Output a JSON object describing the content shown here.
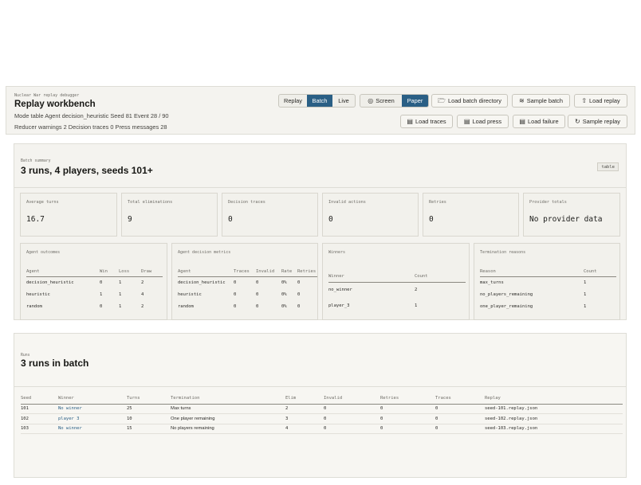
{
  "header": {
    "eyebrow": "Nuclear War replay debugger",
    "title": "Replay workbench",
    "meta_line1": "Mode table  Agent decision_heuristic  Seed 81  Event 28 / 90",
    "meta_line2": "Reducer warnings 2  Decision traces 0  Press messages 28",
    "mode_tabs": [
      "Replay",
      "Batch",
      "Live"
    ],
    "active_mode": "Batch",
    "view_tabs": [
      "Screen",
      "Paper"
    ],
    "active_view": "Paper",
    "buttons_row1": {
      "load_batch_directory": "Load batch directory",
      "sample_batch": "Sample batch",
      "load_replay": "Load replay"
    },
    "buttons_row2": {
      "load_traces": "Load traces",
      "load_press": "Load press",
      "load_failure": "Load failure",
      "sample_replay": "Sample replay"
    }
  },
  "summary": {
    "eyebrow": "Batch summary",
    "title": "3 runs, 4 players, seeds 101+",
    "tag": "table",
    "stats": [
      {
        "label": "Average turns",
        "value": "16.7"
      },
      {
        "label": "Total eliminations",
        "value": "9"
      },
      {
        "label": "Decision traces",
        "value": "0"
      },
      {
        "label": "Invalid actions",
        "value": "0"
      },
      {
        "label": "Retries",
        "value": "0"
      },
      {
        "label": "Provider totals",
        "value": "No provider data"
      }
    ],
    "agent_outcomes": {
      "label": "Agent outcomes",
      "headers": [
        "Agent",
        "Win",
        "Loss",
        "Draw"
      ],
      "rows": [
        {
          "agent": "decision_heuristic",
          "win": "0",
          "loss": "1",
          "draw": "2"
        },
        {
          "agent": "heuristic",
          "win": "1",
          "loss": "1",
          "draw": "4"
        },
        {
          "agent": "random",
          "win": "0",
          "loss": "1",
          "draw": "2"
        }
      ]
    },
    "agent_metrics": {
      "label": "Agent decision metrics",
      "headers": [
        "Agent",
        "Traces",
        "Invalid",
        "Rate",
        "Retries"
      ],
      "rows": [
        {
          "agent": "decision_heuristic",
          "traces": "0",
          "invalid": "0",
          "rate": "0%",
          "retries": "0"
        },
        {
          "agent": "heuristic",
          "traces": "0",
          "invalid": "0",
          "rate": "0%",
          "retries": "0"
        },
        {
          "agent": "random",
          "traces": "0",
          "invalid": "0",
          "rate": "0%",
          "retries": "0"
        }
      ]
    },
    "winners": {
      "label": "Winners",
      "headers": [
        "Winner",
        "Count"
      ],
      "rows": [
        {
          "winner": "no_winner",
          "count": "2"
        },
        {
          "winner": "player_3",
          "count": "1"
        }
      ]
    },
    "termination": {
      "label": "Termination reasons",
      "headers": [
        "Reason",
        "Count"
      ],
      "rows": [
        {
          "reason": "max_turns",
          "count": "1"
        },
        {
          "reason": "no_players_remaining",
          "count": "1"
        },
        {
          "reason": "one_player_remaining",
          "count": "1"
        }
      ]
    }
  },
  "runs": {
    "eyebrow": "Runs",
    "title": "3 runs in batch",
    "headers": [
      "Seed",
      "Winner",
      "Turns",
      "Termination",
      "Elim",
      "Invalid",
      "Retries",
      "Traces",
      "Replay"
    ],
    "rows": [
      {
        "seed": "101",
        "winner": "No winner",
        "turns": "25",
        "termination": "Max turns",
        "elim": "2",
        "invalid": "0",
        "retries": "0",
        "traces": "0",
        "replay": "seed-101.replay.json"
      },
      {
        "seed": "102",
        "winner": "player 3",
        "turns": "10",
        "termination": "One player remaining",
        "elim": "3",
        "invalid": "0",
        "retries": "0",
        "traces": "0",
        "replay": "seed-102.replay.json"
      },
      {
        "seed": "103",
        "winner": "No winner",
        "turns": "15",
        "termination": "No players remaining",
        "elim": "4",
        "invalid": "0",
        "retries": "0",
        "traces": "0",
        "replay": "seed-103.replay.json"
      }
    ]
  },
  "colors": {
    "accent": "#2a5f85",
    "win": "#2f8a3c",
    "loss": "#c0392b",
    "panel": "#f4f3ef"
  }
}
